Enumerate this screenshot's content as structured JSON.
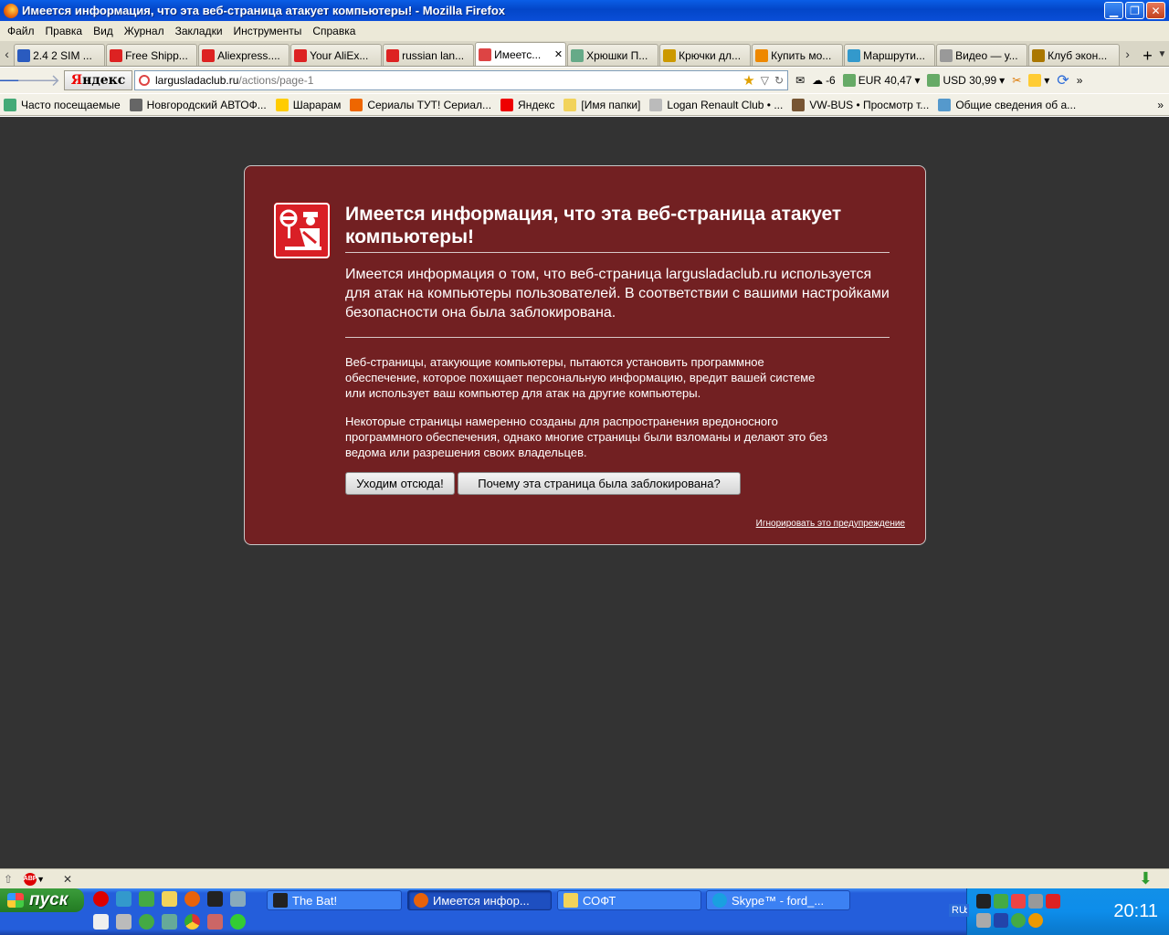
{
  "window": {
    "title": "Имеется информация, что эта веб-страница атакует компьютеры! - Mozilla Firefox",
    "controls": [
      "▁",
      "❐",
      "✕"
    ]
  },
  "menu": [
    "Файл",
    "Правка",
    "Вид",
    "Журнал",
    "Закладки",
    "Инструменты",
    "Справка"
  ],
  "tabs": [
    {
      "label": "2.4 2 SIM ...",
      "color": "#2a5bbf"
    },
    {
      "label": "Free Shipp...",
      "color": "#d22"
    },
    {
      "label": "Aliexpress....",
      "color": "#d22"
    },
    {
      "label": "Your AliEx...",
      "color": "#d22"
    },
    {
      "label": "russian lan...",
      "color": "#d22"
    },
    {
      "label": "Имеетс...",
      "color": "#d44",
      "active": true
    },
    {
      "label": "Хрюшки П...",
      "color": "#6a8"
    },
    {
      "label": "Крючки дл...",
      "color": "#c90"
    },
    {
      "label": "Купить мо...",
      "color": "#e80"
    },
    {
      "label": "Маршрути...",
      "color": "#39c"
    },
    {
      "label": "Видео — у...",
      "color": "#999"
    },
    {
      "label": "Клуб экон...",
      "color": "#a70"
    }
  ],
  "nav": {
    "yandex_y": "Я",
    "yandex_rest": "ндекс",
    "url_domain": "largusladaclub.ru",
    "url_path": "/actions/page-1",
    "weather": "-6",
    "eur": "EUR 40,47",
    "usd": "USD 30,99"
  },
  "bookmarks": [
    {
      "label": "Часто посещаемые",
      "color": "#4a7"
    },
    {
      "label": "Новгородский АВТОФ...",
      "color": "#666"
    },
    {
      "label": "Шарарам",
      "color": "#fc0"
    },
    {
      "label": "Сериалы ТУТ! Сериал...",
      "color": "#e60"
    },
    {
      "label": "Яндекс",
      "color": "#e00"
    },
    {
      "label": "[Имя папки]",
      "color": "#f2d35a"
    },
    {
      "label": "Logan Renault Club • ...",
      "color": "#bbb"
    },
    {
      "label": "VW-BUS • Просмотр т...",
      "color": "#753"
    },
    {
      "label": "Общие сведения об а...",
      "color": "#59c"
    }
  ],
  "bookmarks_more": "»",
  "warning": {
    "title": "Имеется информация, что эта веб-страница атакует компьютеры!",
    "short_desc": "Имеется информация о том, что веб-страница largusladaclub.ru используется для атак на компьютеры пользователей. В соответствии с вашими настройками безопасности она была заблокирована.",
    "long_desc_1": "Веб-страницы, атакующие компьютеры, пытаются установить программное обеспечение, которое похищает персональную информацию, вредит вашей системе или использует ваш компьютер для атак на другие компьютеры.",
    "long_desc_2": "Некоторые страницы намеренно созданы для распространения вредоносного программного обеспечения, однако многие страницы были взломаны и делают это без ведома или разрешения своих владельцев.",
    "btn_leave": "Уходим отсюда!",
    "btn_why": "Почему эта страница была заблокирована?",
    "ignore": "Игнорировать это предупреждение"
  },
  "addon_bar": {
    "abp": "ABP",
    "close": "✕"
  },
  "taskbar": {
    "start": "пуск",
    "tasks": [
      {
        "label": "The Bat!",
        "color": "#222"
      },
      {
        "label": "Имеется инфор...",
        "color": "#e8620a",
        "active": true
      },
      {
        "label": "СОФТ",
        "color": "#f2d35a"
      },
      {
        "label": "Skype™ - ford_...",
        "color": "#1aa0e0"
      }
    ],
    "lang": "RU",
    "time": "20:11"
  }
}
